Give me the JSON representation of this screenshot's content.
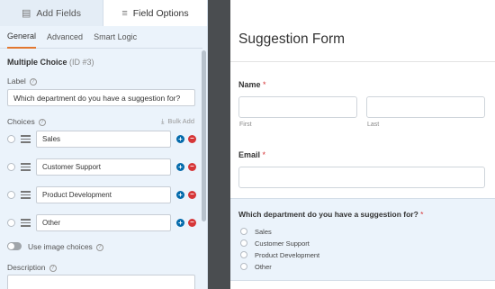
{
  "sidebar": {
    "tabs": [
      {
        "label": "Add Fields",
        "icon": "list-icon"
      },
      {
        "label": "Field Options",
        "icon": "sliders-icon"
      }
    ],
    "subtabs": [
      "General",
      "Advanced",
      "Smart Logic"
    ],
    "field_type": "Multiple Choice",
    "field_id": "(ID #3)",
    "label_title": "Label",
    "label_value": "Which department do you have a suggestion for?",
    "choices_title": "Choices",
    "bulk_add": "Bulk Add",
    "choices": [
      "Sales",
      "Customer Support",
      "Product Development",
      "Other"
    ],
    "image_choices_label": "Use image choices",
    "description_title": "Description"
  },
  "form": {
    "title": "Suggestion Form",
    "name_label": "Name",
    "name_required": "*",
    "first_label": "First",
    "last_label": "Last",
    "email_label": "Email",
    "email_required": "*",
    "question": "Which department do you have a suggestion for?",
    "question_required": "*",
    "options": [
      "Sales",
      "Customer Support",
      "Product Development",
      "Other"
    ]
  },
  "colors": {
    "panel_bg": "#ebf3fb",
    "accent_orange": "#e27730",
    "add_blue": "#036aab",
    "remove_red": "#d63638",
    "gutter": "#4a4d50"
  }
}
